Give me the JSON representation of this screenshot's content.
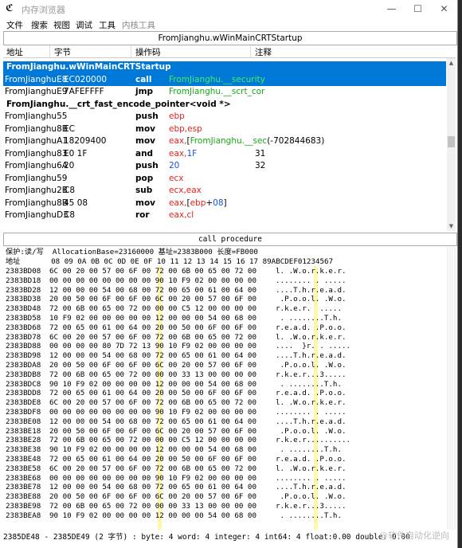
{
  "window": {
    "title": "内存浏览器",
    "buttons": {
      "minimize": "—",
      "maximize": "☐",
      "close": "✕"
    }
  },
  "menu": [
    "文件",
    "搜索",
    "视图",
    "调试",
    "工具",
    "内核工具"
  ],
  "disasm": {
    "panel_title": "FromJianghu.wWinMainCRTStartup",
    "columns": [
      "地址",
      "字节",
      "操作码",
      "注释"
    ],
    "rows": [
      {
        "kind": "header",
        "text": "FromJianghu.wWinMainCRTStartup",
        "selected": true
      },
      {
        "kind": "code",
        "addr": "FromJianghuE8",
        "bytes": "EC020000",
        "mnem": "call",
        "ops": [
          {
            "t": "FromJianghu.__security",
            "c": "green"
          }
        ],
        "comment": "",
        "selected": true
      },
      {
        "kind": "code",
        "addr": "FromJianghuE9",
        "bytes": "7AFEFFFF",
        "mnem": "jmp",
        "ops": [
          {
            "t": "FromJianghu.__scrt_cor",
            "c": "green"
          }
        ],
        "comment": ""
      },
      {
        "kind": "header",
        "text": "FromJianghu.__crt_fast_encode_pointer<void *>"
      },
      {
        "kind": "code",
        "addr": "FromJianghu55",
        "bytes": "",
        "mnem": "push",
        "ops": [
          {
            "t": "ebp",
            "c": "red"
          }
        ],
        "comment": ""
      },
      {
        "kind": "code",
        "addr": "FromJianghu8B",
        "bytes": "EC",
        "mnem": "mov",
        "ops": [
          {
            "t": "ebp,esp",
            "c": "red"
          }
        ],
        "comment": ""
      },
      {
        "kind": "code",
        "addr": "FromJianghuA1",
        "bytes": "18209400",
        "mnem": "mov",
        "ops": [
          {
            "t": "eax,",
            "c": "red"
          },
          {
            "t": "[",
            "c": ""
          },
          {
            "t": "FromJianghu.__sec",
            "c": "green"
          },
          {
            "t": "(-702844683)",
            "c": ""
          }
        ],
        "comment": ""
      },
      {
        "kind": "code",
        "addr": "FromJianghu83",
        "bytes": "E0 1F",
        "mnem": "and",
        "ops": [
          {
            "t": "eax,",
            "c": "red"
          },
          {
            "t": "1F",
            "c": "blue"
          }
        ],
        "comment": "31"
      },
      {
        "kind": "code",
        "addr": "FromJianghu6A",
        "bytes": "20",
        "mnem": "push",
        "ops": [
          {
            "t": "20",
            "c": "blue"
          }
        ],
        "comment": "32"
      },
      {
        "kind": "code",
        "addr": "FromJianghu59",
        "bytes": "",
        "mnem": "pop",
        "ops": [
          {
            "t": "ecx",
            "c": "red"
          }
        ],
        "comment": ""
      },
      {
        "kind": "code",
        "addr": "FromJianghu2B",
        "bytes": "C8",
        "mnem": "sub",
        "ops": [
          {
            "t": "ecx,eax",
            "c": "red"
          }
        ],
        "comment": ""
      },
      {
        "kind": "code",
        "addr": "FromJianghu8B",
        "bytes": "45 08",
        "mnem": "mov",
        "ops": [
          {
            "t": "eax,",
            "c": "red"
          },
          {
            "t": "[",
            "c": ""
          },
          {
            "t": "ebp",
            "c": "red"
          },
          {
            "t": "+",
            "c": ""
          },
          {
            "t": "08",
            "c": "blue"
          },
          {
            "t": "]",
            "c": ""
          }
        ],
        "comment": ""
      },
      {
        "kind": "code",
        "addr": "FromJianghuD3",
        "bytes": "C8",
        "mnem": "ror",
        "ops": [
          {
            "t": "eax,cl",
            "c": "red"
          }
        ],
        "comment": ""
      }
    ],
    "status": "call procedure"
  },
  "hexview": {
    "protection_line": "保护:读/写  AllocationBase=23160000 基址=2383B000 长度=FB000",
    "header_line": "地址       08 09 0A 0B 0C 0D 0E 0F 10 11 12 13 14 15 16 17 89ABCDEF01234567",
    "rows": [
      {
        "a": "2383BD08",
        "h": "6C 00 20 00 57 00 6F 00 72 00 6B 00 65 00 72 00",
        "s": "l. .W.o.r.k.e.r."
      },
      {
        "a": "2383BD18",
        "h": "00 00 00 00 00 00 00 00 90 10 F9 02 00 00 00 00",
        "s": "........ . ....."
      },
      {
        "a": "2383BD28",
        "h": "12 00 00 00 54 00 68 00 72 00 65 00 61 00 64 00",
        "s": "....T.h.r.e.a.d."
      },
      {
        "a": "2383BD38",
        "h": "20 00 50 00 6F 00 6F 00 6C 00 20 00 57 00 6F 00",
        "s": " .P.o.o.l. .W.o."
      },
      {
        "a": "2383BD48",
        "h": "72 00 6B 00 65 00 72 00 00 00 C5 12 00 00 00 00",
        "s": "r.k.e.r.  .....  "
      },
      {
        "a": "2383BD58",
        "h": "10 F9 02 00 00 00 00 00 12 00 00 00 54 00 68 00",
        "s": " . ........T.h."
      },
      {
        "a": "2383BD68",
        "h": "72 00 65 00 61 00 64 00 20 00 50 00 6F 00 6F 00",
        "s": "r.e.a.d. .P.o.o."
      },
      {
        "a": "2383BD78",
        "h": "6C 00 20 00 57 00 6F 00 72 00 6B 00 65 00 72 00",
        "s": "l. .W.o.r.k.e.r."
      },
      {
        "a": "2383BD88",
        "h": "00 00 00 00 80 7D 72 13 90 10 F9 02 00 00 00 00",
        "s": "....  }r. . ....."
      },
      {
        "a": "2383BD98",
        "h": "12 00 00 00 54 00 68 00 72 00 65 00 61 00 64 00",
        "s": "....T.h.r.e.a.d."
      },
      {
        "a": "2383BDA8",
        "h": "20 00 50 00 6F 00 6F 00 6C 00 20 00 57 00 6F 00",
        "s": " .P.o.o.l. .W.o."
      },
      {
        "a": "2383BDB8",
        "h": "72 00 6B 00 65 00 72 00 00 00 33 13 00 00 00 00",
        "s": "r.k.e.r...3....."
      },
      {
        "a": "2383BDC8",
        "h": "90 10 F9 02 00 00 00 00 12 00 00 00 54 00 68 00",
        "s": " . ........T.h."
      },
      {
        "a": "2383BDD8",
        "h": "72 00 65 00 61 00 64 00 20 00 50 00 6F 00 6F 00",
        "s": "r.e.a.d. .P.o.o."
      },
      {
        "a": "2383BDE8",
        "h": "6C 00 20 00 57 00 6F 00 72 00 6B 00 65 00 72 00",
        "s": "l. .W.o.r.k.e.r."
      },
      {
        "a": "2383BDF8",
        "h": "00 00 00 00 00 00 00 00 90 10 F9 02 00 00 00 00",
        "s": "........ . ....."
      },
      {
        "a": "2383BE08",
        "h": "12 00 00 00 54 00 68 00 72 00 65 00 61 00 64 00",
        "s": "....T.h.r.e.a.d."
      },
      {
        "a": "2383BE18",
        "h": "20 00 50 00 6F 00 6F 00 6C 00 20 00 57 00 6F 00",
        "s": " .P.o.o.l. .W.o."
      },
      {
        "a": "2383BE28",
        "h": "72 00 6B 00 65 00 72 00 00 00 C5 12 00 00 00 00",
        "s": "r.k.e.r.........."
      },
      {
        "a": "2383BE38",
        "h": "90 10 F9 02 00 00 00 00 12 00 00 00 54 00 68 00",
        "s": " . ........T.h."
      },
      {
        "a": "2383BE48",
        "h": "72 00 65 00 61 00 64 00 20 00 50 00 6F 00 6F 00",
        "s": "r.e.a.d. .P.o.o."
      },
      {
        "a": "2383BE58",
        "h": "6C 00 20 00 57 00 6F 00 72 00 6B 00 65 00 72 00",
        "s": "l. .W.o.r.k.e.r."
      },
      {
        "a": "2383BE68",
        "h": "00 00 00 00 00 00 00 00 90 10 F9 02 00 00 00 00",
        "s": "........ . ....."
      },
      {
        "a": "2383BE78",
        "h": "12 00 00 00 54 00 68 00 72 00 65 00 61 00 64 00",
        "s": "....T.h.r.e.a.d."
      },
      {
        "a": "2383BE88",
        "h": "20 00 50 00 6F 00 6F 00 6C 00 20 00 57 00 6F 00",
        "s": " .P.o.o.l. .W.o."
      },
      {
        "a": "2383BE98",
        "h": "72 00 6B 00 65 00 72 00 00 00 33 13 00 00 00 00",
        "s": "r.k.e.r...3....."
      },
      {
        "a": "2383BEA8",
        "h": "90 10 F9 02 00 00 00 00 12 00 00 00 54 00 68 00",
        "s": " . ........T.h."
      }
    ]
  },
  "statusbar": "2385DE48 - 2385DE49 (2 字节) : byte: 4 word: 4 integer: 4 int64: 4 float:0.00 double: 0.00",
  "watermark": "@软件自动化逆向"
}
